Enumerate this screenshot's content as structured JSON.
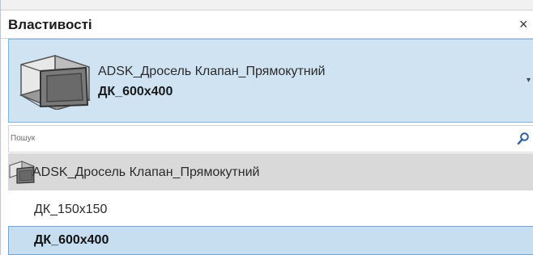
{
  "panel": {
    "title": "Властивості",
    "close_symbol": "×"
  },
  "type_selector": {
    "family_name": "ADSK_Дросель Клапан_Прямокутний",
    "type_name": "ДК_600x400",
    "thumbnail_icon": "damper-3d-icon",
    "arrow_icon": "dropdown-arrow-icon"
  },
  "search": {
    "placeholder": "Пошук",
    "value": "",
    "icon": "search-icon"
  },
  "list": {
    "family": {
      "label": "ADSK_Дросель Клапан_Прямокутний",
      "icon": "damper-3d-icon"
    },
    "types": [
      {
        "label": "ДК_150x150",
        "selected": false
      },
      {
        "label": "ДК_600x400",
        "selected": true
      }
    ]
  },
  "colors": {
    "selection_bg": "#c7def0",
    "selection_border": "#6fa6d3",
    "family_row_bg": "#d9d9d9"
  }
}
